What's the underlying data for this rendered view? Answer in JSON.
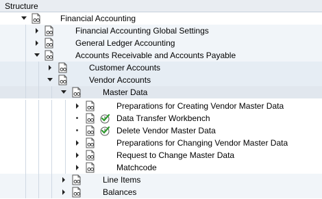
{
  "header": {
    "title": "Structure"
  },
  "tree": [
    {
      "label": "Financial Accounting",
      "toggle": "down"
    },
    {
      "label": "Financial Accounting Global Settings",
      "toggle": "right"
    },
    {
      "label": "General Ledger Accounting",
      "toggle": "right"
    },
    {
      "label": "Accounts Receivable and Accounts Payable",
      "toggle": "down"
    },
    {
      "label": "Customer Accounts",
      "toggle": "right"
    },
    {
      "label": "Vendor Accounts",
      "toggle": "down"
    },
    {
      "label": "Master Data",
      "toggle": "down"
    },
    {
      "label": "Preparations for Creating Vendor Master Data",
      "toggle": "right"
    },
    {
      "label": "Data Transfer Workbench",
      "toggle": "bullet",
      "executable": true
    },
    {
      "label": "Delete Vendor Master Data",
      "toggle": "bullet",
      "executable": true
    },
    {
      "label": "Preparations for Changing Vendor Master Data",
      "toggle": "right"
    },
    {
      "label": "Request to Change Master Data",
      "toggle": "right"
    },
    {
      "label": "Matchcode",
      "toggle": "right"
    },
    {
      "label": "Line Items",
      "toggle": "right"
    },
    {
      "label": "Balances",
      "toggle": "right"
    }
  ]
}
